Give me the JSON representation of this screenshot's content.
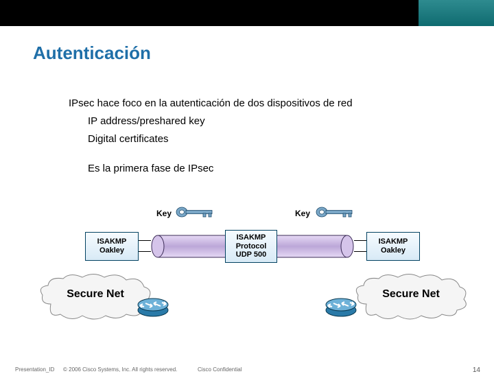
{
  "title": "Autenticación",
  "content": {
    "line1": "IPsec hace foco en la autenticación de dos dispositivos de red",
    "line2": "IP address/preshared key",
    "line3": "Digital certificates",
    "line4": "Es la primera fase de IPsec"
  },
  "diagram": {
    "key_label_left": "Key",
    "key_label_right": "Key",
    "box_left_l1": "ISAKMP",
    "box_left_l2": "Oakley",
    "box_mid_l1": "ISAKMP",
    "box_mid_l2": "Protocol",
    "box_mid_l3": "UDP 500",
    "box_right_l1": "ISAKMP",
    "box_right_l2": "Oakley",
    "cloud_left": "Secure Net",
    "cloud_right": "Secure Net"
  },
  "footer": {
    "presentation_id": "Presentation_ID",
    "copyright": "© 2006 Cisco Systems, Inc. All rights reserved.",
    "confidential": "Cisco Confidential",
    "page": "14"
  }
}
